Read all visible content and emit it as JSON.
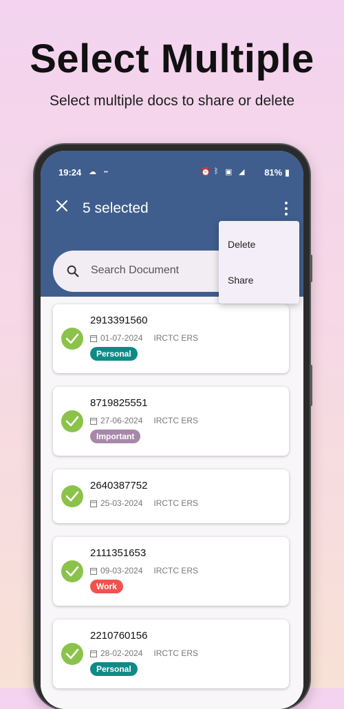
{
  "headline": "Select Multiple",
  "subheadline": "Select multiple docs to share or delete",
  "status_bar": {
    "time": "19:24",
    "battery": "81%"
  },
  "app_bar": {
    "selection_title": "5 selected"
  },
  "search": {
    "placeholder": "Search Document"
  },
  "menu": {
    "items": [
      "Delete",
      "Share"
    ]
  },
  "documents": [
    {
      "number": "2913391560",
      "date": "01-07-2024",
      "source": "IRCTC ERS",
      "tag": "Personal",
      "tag_color": "#108a87"
    },
    {
      "number": "8719825551",
      "date": "27-06-2024",
      "source": "IRCTC ERS",
      "tag": "Important",
      "tag_color": "#a888a8"
    },
    {
      "number": "2640387752",
      "date": "25-03-2024",
      "source": "IRCTC ERS",
      "tag": "",
      "tag_color": ""
    },
    {
      "number": "2111351653",
      "date": "09-03-2024",
      "source": "IRCTC ERS",
      "tag": "Work",
      "tag_color": "#ef5350"
    },
    {
      "number": "2210760156",
      "date": "28-02-2024",
      "source": "IRCTC ERS",
      "tag": "Personal",
      "tag_color": "#108a87"
    }
  ],
  "colors": {
    "app_bar": "#3f5e8d",
    "selected_check": "#8bc34a"
  }
}
